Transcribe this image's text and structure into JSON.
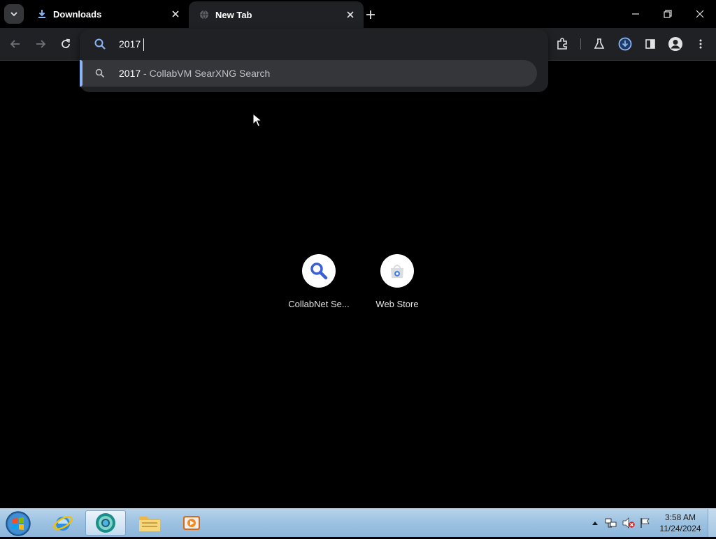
{
  "browser": {
    "tabs": [
      {
        "title": "Downloads",
        "favicon": "download-icon",
        "active": false
      },
      {
        "title": "New Tab",
        "favicon": "globe-icon",
        "active": true
      }
    ],
    "omnibox": {
      "value": "2017",
      "suggestion": {
        "query": "2017",
        "separator": "-",
        "engine": "CollabVM SearXNG Search"
      }
    },
    "shortcuts": [
      {
        "label": "CollabNet Se...",
        "icon": "search-icon"
      },
      {
        "label": "Web Store",
        "icon": "webstore-icon"
      }
    ],
    "colors": {
      "accent": "#8ab4f8",
      "toolbar": "#202124",
      "background": "#000000"
    }
  },
  "taskbar": {
    "pinned": [
      "windows-start",
      "internet-explorer",
      "chromium",
      "file-explorer",
      "media-player"
    ],
    "clock": {
      "time": "3:58 AM",
      "date": "11/24/2024"
    }
  }
}
